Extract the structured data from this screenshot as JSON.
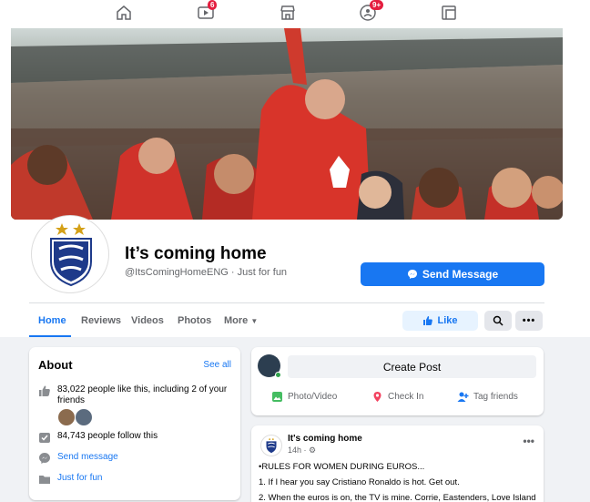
{
  "nav": {
    "home_icon": "home-icon",
    "watch_badge": "6",
    "groups_badge": "9+"
  },
  "page": {
    "title": "It’s coming home",
    "handle": "@ItsComingHomeENG · Just for fun",
    "send_message": "Send Message",
    "like": "Like"
  },
  "tabs": [
    "Home",
    "Reviews",
    "Videos",
    "Photos",
    "More"
  ],
  "about": {
    "title": "About",
    "see_all": "See all",
    "likes_line1": "83,022 people like this, including 2 of your",
    "likes_line2": "friends",
    "follows": "84,743 people follow this",
    "send_message": "Send message",
    "category": "Just for fun"
  },
  "create_post": {
    "label": "Create Post",
    "photo_video": "Photo/Video",
    "check_in": "Check In",
    "tag_friends": "Tag friends"
  },
  "post": {
    "author": "It's coming home",
    "time": "14h · ⚙",
    "lines": [
      "•RULES FOR WOMEN DURING EUROS...",
      "1. If I hear you say Cristiano Ronaldo is hot. Get out.",
      "2. When the euros is on, the TV is mine. Corrie, Eastenders, Love Island"
    ]
  },
  "colors": {
    "accent": "#1877f2",
    "badge": "#e41e3f"
  }
}
